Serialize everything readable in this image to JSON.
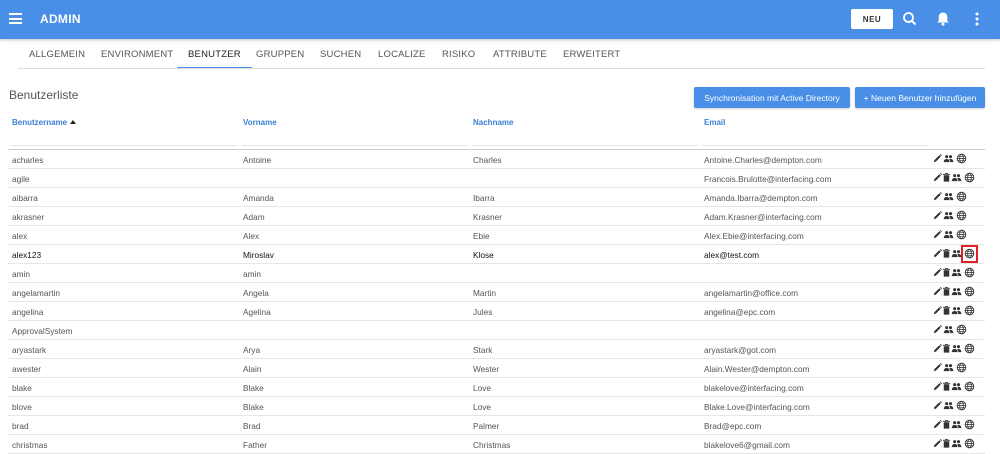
{
  "header": {
    "app_title": "ADMIN",
    "new_label": "NEU",
    "menu_icon": "hamburger-menu-icon",
    "search_icon": "search-icon",
    "bell_icon": "notifications-bell-icon",
    "more_icon": "more-vert-icon"
  },
  "tabs": [
    {
      "label": "ALLGEMEIN",
      "active": false
    },
    {
      "label": "ENVIRONMENT",
      "active": false
    },
    {
      "label": "BENUTZER",
      "active": true
    },
    {
      "label": "GRUPPEN",
      "active": false
    },
    {
      "label": "SUCHEN",
      "active": false
    },
    {
      "label": "LOCALIZE",
      "active": false
    },
    {
      "label": "RISIKO",
      "active": false
    },
    {
      "label": "ATTRIBUTE",
      "active": false
    },
    {
      "label": "ERWEITERT",
      "active": false
    }
  ],
  "section": {
    "title": "Benutzerliste",
    "sync_button": "Synchronisation mit Active Directory",
    "add_button": "+ Neuen Benutzer hinzufügen"
  },
  "table": {
    "columns": [
      "Benutzername",
      "Vorname",
      "Nachname",
      "Email"
    ],
    "sorted_column": "Benutzername",
    "sort_direction": "ascending",
    "filters": [
      "",
      "",
      "",
      ""
    ],
    "action_icons": [
      "edit-pencil-icon",
      "delete-trash-icon",
      "groups-people-icon",
      "localize-globe-icon"
    ],
    "rows": [
      {
        "username": "acharles",
        "first": "Antoine",
        "last": "Charles",
        "email": "Antoine.Charles@dempton.com",
        "deletable": false,
        "selected": false
      },
      {
        "username": "agile",
        "first": "",
        "last": "",
        "email": "Francois.Brulotte@interfacing.com",
        "deletable": true,
        "selected": false
      },
      {
        "username": "aibarra",
        "first": "Amanda",
        "last": "Ibarra",
        "email": "Amanda.Ibarra@dempton.com",
        "deletable": false,
        "selected": false
      },
      {
        "username": "akrasner",
        "first": "Adam",
        "last": "Krasner",
        "email": "Adam.Krasner@interfacing.com",
        "deletable": false,
        "selected": false
      },
      {
        "username": "alex",
        "first": "Alex",
        "last": "Ebie",
        "email": "Alex.Ebie@interfacing.com",
        "deletable": false,
        "selected": false
      },
      {
        "username": "alex123",
        "first": "Miroslav",
        "last": "Klose",
        "email": "alex@test.com",
        "deletable": true,
        "selected": true
      },
      {
        "username": "amin",
        "first": "amin",
        "last": "",
        "email": "",
        "deletable": true,
        "selected": false
      },
      {
        "username": "angelamartin",
        "first": "Angela",
        "last": "Martin",
        "email": "angelamartin@office.com",
        "deletable": true,
        "selected": false
      },
      {
        "username": "angelina",
        "first": "Agelina",
        "last": "Jules",
        "email": "angelina@epc.com",
        "deletable": true,
        "selected": false
      },
      {
        "username": "ApprovalSystem",
        "first": "",
        "last": "",
        "email": "",
        "deletable": false,
        "selected": false
      },
      {
        "username": "aryastark",
        "first": "Arya",
        "last": "Stark",
        "email": "aryastark@got.com",
        "deletable": true,
        "selected": false
      },
      {
        "username": "awester",
        "first": "Alain",
        "last": "Wester",
        "email": "Alain.Wester@dempton.com",
        "deletable": false,
        "selected": false
      },
      {
        "username": "blake",
        "first": "Blake",
        "last": "Love",
        "email": "blakelove@interfacing.com",
        "deletable": true,
        "selected": false
      },
      {
        "username": "blove",
        "first": "Blake",
        "last": "Love",
        "email": "Blake.Love@interfacing.com",
        "deletable": false,
        "selected": false
      },
      {
        "username": "brad",
        "first": "Brad",
        "last": "Palmer",
        "email": "Brad@epc.com",
        "deletable": true,
        "selected": false
      },
      {
        "username": "christmas",
        "first": "Father",
        "last": "Christmas",
        "email": "blakelove6@gmail.com",
        "deletable": true,
        "selected": false
      }
    ]
  },
  "colors": {
    "primary": "#4a8fe7",
    "header_text": "#3a7fd5",
    "highlight": "#e0202a"
  }
}
